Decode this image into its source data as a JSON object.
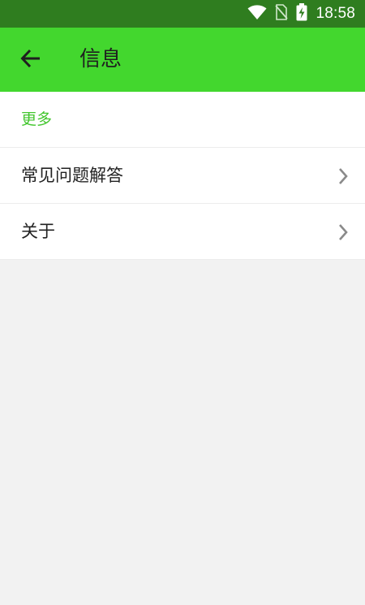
{
  "status_bar": {
    "time": "18:58",
    "icons": [
      "wifi-icon",
      "no-sim-icon",
      "battery-charging-icon"
    ]
  },
  "app_bar": {
    "back_icon": "arrow-left-icon",
    "title": "信息"
  },
  "section": {
    "header": "更多",
    "items": [
      {
        "label": "常见问题解答",
        "icon": "chevron-right-icon"
      },
      {
        "label": "关于",
        "icon": "chevron-right-icon"
      }
    ]
  },
  "colors": {
    "status_bar": "#2f7d1f",
    "app_bar": "#43d72e",
    "accent": "#43c62e",
    "background": "#f2f2f2"
  }
}
